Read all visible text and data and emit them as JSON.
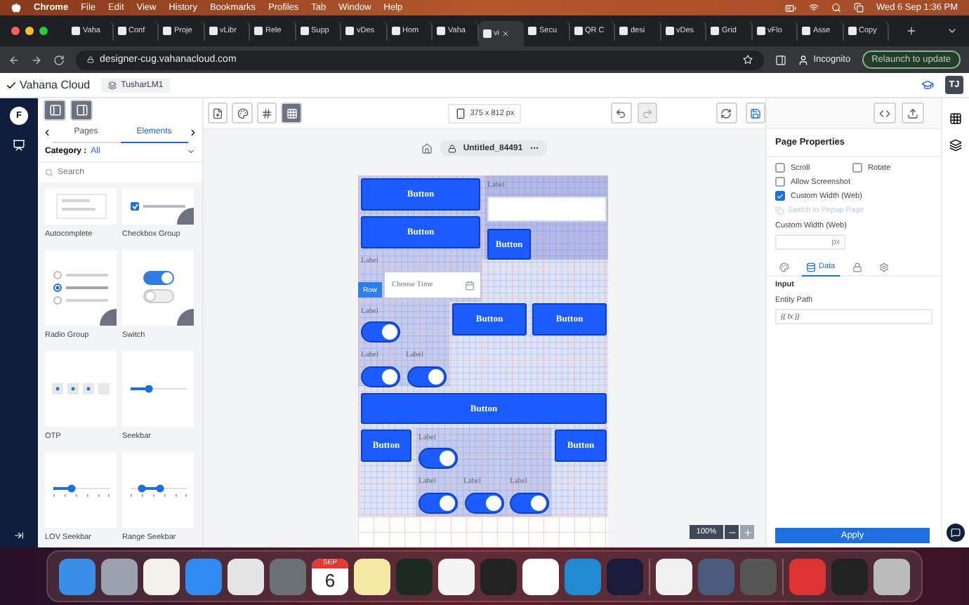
{
  "menu_bar": {
    "items": [
      "Chrome",
      "File",
      "Edit",
      "View",
      "History",
      "Bookmarks",
      "Profiles",
      "Tab",
      "Window",
      "Help"
    ],
    "clock": "Wed 6 Sep  1:36 PM"
  },
  "browser": {
    "tabs": [
      {
        "title": "Vaha",
        "selected": false
      },
      {
        "title": "Conf",
        "selected": false
      },
      {
        "title": "Proje",
        "selected": false
      },
      {
        "title": "vLibr",
        "selected": false
      },
      {
        "title": "Rele",
        "selected": false
      },
      {
        "title": "Supp",
        "selected": false
      },
      {
        "title": "vDes",
        "selected": false
      },
      {
        "title": "Hom",
        "selected": false
      },
      {
        "title": "Vaha",
        "selected": false
      },
      {
        "title": "vi",
        "selected": true
      },
      {
        "title": "Secu",
        "selected": false
      },
      {
        "title": "QR C",
        "selected": false
      },
      {
        "title": "desi",
        "selected": false
      },
      {
        "title": "vDes",
        "selected": false
      },
      {
        "title": "Grid",
        "selected": false
      },
      {
        "title": "vFlo",
        "selected": false
      },
      {
        "title": "Asse",
        "selected": false
      },
      {
        "title": "Copy",
        "selected": false
      }
    ],
    "url": "designer-cug.vahanacloud.com",
    "profile": "Incognito",
    "update_button": "Relaunch to update"
  },
  "app": {
    "brand": "Vahana Cloud",
    "workspace": "TusharLM1",
    "user_initials": "TJ",
    "rail_avatar": "F"
  },
  "left_panel": {
    "tabs": [
      {
        "label": "Pages",
        "selected": false
      },
      {
        "label": "Elements",
        "selected": true
      }
    ],
    "category_label": "Category :",
    "category_value": "All",
    "search_placeholder": "Search",
    "elements": [
      {
        "label": "Autocomplete",
        "kind": "autocomplete",
        "corner_badge": false
      },
      {
        "label": "Checkbox Group",
        "kind": "checkbox",
        "corner_badge": true
      },
      {
        "label": "Radio Group",
        "kind": "radio",
        "corner_badge": true
      },
      {
        "label": "Switch",
        "kind": "switch",
        "corner_badge": true
      },
      {
        "label": "OTP",
        "kind": "otp",
        "corner_badge": false
      },
      {
        "label": "Seekbar",
        "kind": "seekbar",
        "corner_badge": false
      },
      {
        "label": "LOV Seekbar",
        "kind": "lov",
        "corner_badge": false
      },
      {
        "label": "Range Seekbar",
        "kind": "range",
        "corner_badge": false
      }
    ]
  },
  "canvas": {
    "screen_size": "375 x 812 px",
    "page_title": "Untitled_84491",
    "zoom": "100%",
    "widgets": [
      {
        "kind": "button",
        "text": "Button"
      },
      {
        "kind": "label",
        "text": "Label"
      },
      {
        "kind": "input"
      },
      {
        "kind": "button",
        "text": "Button"
      },
      {
        "kind": "button",
        "text": "Button"
      },
      {
        "kind": "label",
        "text": "Label"
      },
      {
        "kind": "time",
        "placeholder": "Choose Time"
      },
      {
        "kind": "tag",
        "text": "Row"
      },
      {
        "kind": "label",
        "text": "Label"
      },
      {
        "kind": "switch",
        "on": true
      },
      {
        "kind": "button",
        "text": "Button"
      },
      {
        "kind": "button",
        "text": "Button"
      },
      {
        "kind": "label",
        "text": "Label"
      },
      {
        "kind": "label",
        "text": "Label"
      },
      {
        "kind": "switch",
        "on": true
      },
      {
        "kind": "switch",
        "on": true
      },
      {
        "kind": "button",
        "text": "Button"
      },
      {
        "kind": "button",
        "text": "Button"
      },
      {
        "kind": "label",
        "text": "Label"
      },
      {
        "kind": "switch",
        "on": true
      },
      {
        "kind": "button",
        "text": "Button"
      },
      {
        "kind": "label",
        "text": "Label"
      },
      {
        "kind": "label",
        "text": "Label"
      },
      {
        "kind": "label",
        "text": "Label"
      },
      {
        "kind": "switch",
        "on": true
      },
      {
        "kind": "switch",
        "on": true
      },
      {
        "kind": "switch",
        "on": true
      }
    ]
  },
  "right_panel": {
    "title": "Page Properties",
    "options": [
      {
        "label": "Scroll",
        "checked": false
      },
      {
        "label": "Rotate",
        "checked": false
      },
      {
        "label": "Allow Screenshot",
        "checked": false
      },
      {
        "label": "Custom Width (Web)",
        "checked": true
      }
    ],
    "popup_link": {
      "label": "Switch to Popup Page",
      "disabled": true
    },
    "width_label": "Custom Width (Web)",
    "width_unit": "px",
    "tabs": [
      {
        "kind": "style",
        "selected": false
      },
      {
        "kind": "data",
        "label": "Data",
        "selected": true
      },
      {
        "kind": "lock",
        "selected": false
      },
      {
        "kind": "actions",
        "selected": false
      }
    ],
    "section": "Input",
    "entity_label": "Entity Path",
    "entity_value": "{{ fx }}",
    "apply_button": "Apply"
  },
  "dock": {
    "calendar_month": "SEP",
    "calendar_day": "6"
  }
}
